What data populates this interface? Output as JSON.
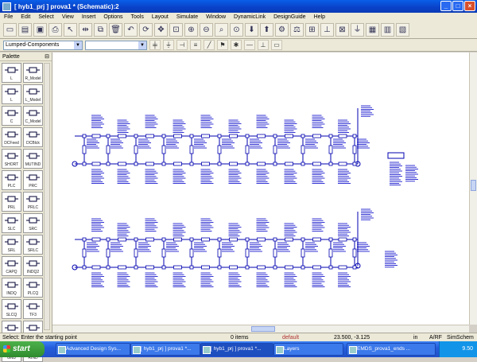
{
  "window": {
    "title": "[ hyb1_prj ] prova1 * (Schematic):2"
  },
  "menu": [
    "File",
    "Edit",
    "Select",
    "View",
    "Insert",
    "Options",
    "Tools",
    "Layout",
    "Simulate",
    "Window",
    "DynamicLink",
    "DesignGuide",
    "Help"
  ],
  "toolbar2": {
    "library_value": "Lumped-Components",
    "component_value": ""
  },
  "palette": {
    "title": "Palette",
    "items": [
      {
        "label": "L",
        "icon": "inductor-icon"
      },
      {
        "label": "R_Model",
        "icon": "resistor-model-icon"
      },
      {
        "label": "L",
        "icon": "inductor-icon"
      },
      {
        "label": "L_Model",
        "icon": "inductor-model-icon"
      },
      {
        "label": "C",
        "icon": "capacitor-icon"
      },
      {
        "label": "C_Model",
        "icon": "capacitor-model-icon"
      },
      {
        "label": "DCFeed",
        "icon": "dcfeed-icon"
      },
      {
        "label": "DCBlck",
        "icon": "dcblock-icon"
      },
      {
        "label": "SHORT",
        "icon": "short-icon"
      },
      {
        "label": "MUTIND",
        "icon": "mutual-inductor-icon"
      },
      {
        "label": "PLC",
        "icon": "plc-icon"
      },
      {
        "label": "PRC",
        "icon": "prc-icon"
      },
      {
        "label": "PRL",
        "icon": "prl-icon"
      },
      {
        "label": "PRLC",
        "icon": "prlc-icon"
      },
      {
        "label": "SLC",
        "icon": "slc-icon"
      },
      {
        "label": "SRC",
        "icon": "src-icon"
      },
      {
        "label": "SRL",
        "icon": "srl-icon"
      },
      {
        "label": "SRLC",
        "icon": "srlc-icon"
      },
      {
        "label": "CAPQ",
        "icon": "capq-icon"
      },
      {
        "label": "INDQ2",
        "icon": "indq2-icon"
      },
      {
        "label": "INDQ",
        "icon": "indq-icon"
      },
      {
        "label": "PLCQ",
        "icon": "plcq-icon"
      },
      {
        "label": "SLCQ",
        "icon": "slcq-icon"
      },
      {
        "label": "TF3",
        "icon": "tf3-icon"
      },
      {
        "label": "TF",
        "icon": "transformer-icon"
      },
      {
        "label": "CAPP2",
        "icon": "capp2-icon"
      },
      {
        "label": "GND",
        "icon": "ground-icon"
      },
      {
        "label": "RIND",
        "icon": "rind-icon"
      }
    ]
  },
  "status": {
    "prompt": "Select: Enter the starting point",
    "items": "0 items",
    "layer": "default",
    "coords": "23.500, -3.125",
    "unit": "in",
    "mode": "A/RF",
    "sim": "SimSchem"
  },
  "taskbar": {
    "start": "start",
    "tasks": [
      "Advanced Design Sys...",
      "[ hyb1_prj ] prova1 *...",
      "[ hyb1_prj ] prova1 *...",
      "Layers",
      "EMDS_prova1_ends ..."
    ],
    "clock": "9.50"
  },
  "colors": {
    "wire": "#0000b0",
    "label": "#0000c8",
    "titlebar": "#0941c8"
  }
}
